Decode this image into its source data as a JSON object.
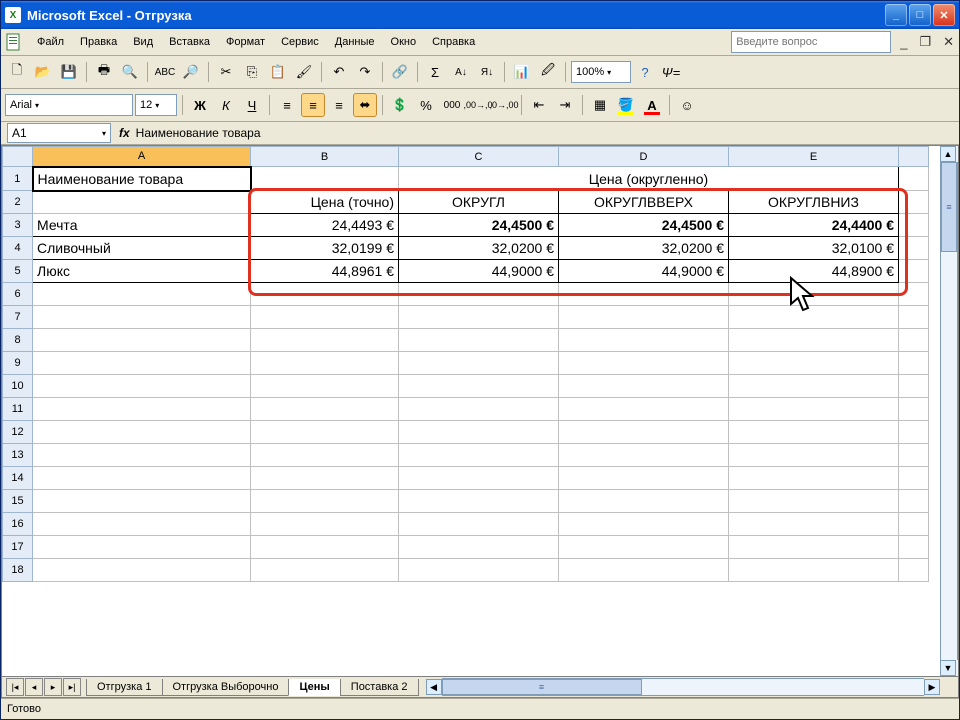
{
  "title": "Microsoft Excel - Отгрузка",
  "menu": {
    "file": "Файл",
    "edit": "Правка",
    "view": "Вид",
    "insert": "Вставка",
    "format": "Формат",
    "tools": "Сервис",
    "data": "Данные",
    "window": "Окно",
    "help": "Справка"
  },
  "helpPlaceholder": "Введите вопрос",
  "font": {
    "name": "Arial",
    "size": "12"
  },
  "zoom": "100%",
  "nameBox": "A1",
  "formula": "Наименование товара",
  "columns": [
    "A",
    "B",
    "C",
    "D",
    "E"
  ],
  "rowNumbers": [
    1,
    2,
    3,
    4,
    5,
    6,
    7,
    8,
    9,
    10,
    11,
    12,
    13,
    14,
    15,
    16,
    17,
    18
  ],
  "cells": {
    "r1": {
      "a": "Наименование товара",
      "d_merged": "Цена (округленно)"
    },
    "r2": {
      "b": "Цена (точно)",
      "c": "ОКРУГЛ",
      "d": "ОКРУГЛВВЕРХ",
      "e": "ОКРУГЛВНИЗ"
    },
    "r3": {
      "a": "Мечта",
      "b": "24,4493 €",
      "c": "24,4500 €",
      "d": "24,4500 €",
      "e": "24,4400 €"
    },
    "r4": {
      "a": "Сливочный",
      "b": "32,0199 €",
      "c": "32,0200 €",
      "d": "32,0200 €",
      "e": "32,0100 €"
    },
    "r5": {
      "a": "Люкс",
      "b": "44,8961 €",
      "c": "44,9000 €",
      "d": "44,9000 €",
      "e": "44,8900 €"
    }
  },
  "sheets": {
    "s1": "Отгрузка 1",
    "s2": "Отгрузка Выборочно",
    "s3": "Цены",
    "s4": "Поставка 2"
  },
  "status": "Готово",
  "icons": {
    "bold": "Ж",
    "italic": "К",
    "underline": "Ч",
    "currency": "%",
    "sum": "Σ",
    "sortAsc": "А↓",
    "sortDesc": "Я↓"
  }
}
